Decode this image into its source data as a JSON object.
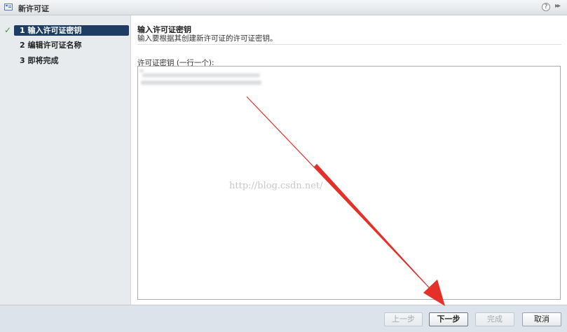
{
  "window": {
    "title": "新许可证"
  },
  "steps": [
    {
      "number": "1",
      "label": "输入许可证密钥",
      "state": "active"
    },
    {
      "number": "2",
      "label": "编辑许可证名称",
      "state": "pending"
    },
    {
      "number": "3",
      "label": "即将完成",
      "state": "pending"
    }
  ],
  "main": {
    "title": "输入许可证密钥",
    "description": "输入要根据其创建新许可证的许可证密钥。",
    "field_label": "许可证密钥 (一行一个):",
    "watermark": "http://blog.csdn.net/"
  },
  "footer": {
    "back_label": "上一步",
    "next_label": "下一步",
    "finish_label": "完成",
    "cancel_label": "取消"
  },
  "colors": {
    "active_step_bg": "#1f3d63",
    "check_mark": "#3c9a2a",
    "annotation_arrow": "#e5302a"
  }
}
